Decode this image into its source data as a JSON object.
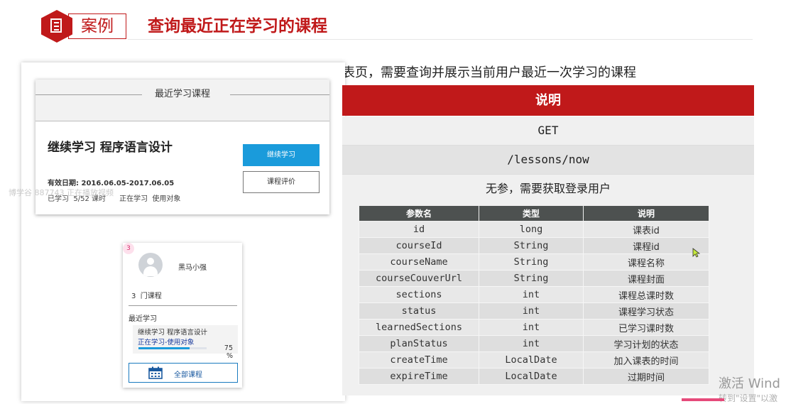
{
  "header": {
    "tag": "案例",
    "title": "查询最近正在学习的课程"
  },
  "intro_text": "表页，需要查询并展示当前用户最近一次学习的课程",
  "left_panel": {
    "card1": {
      "title": "最近学习课程",
      "course_line": "继续学习 程序语言设计",
      "valid_date": "有效日期: 2016.06.05-2017.06.05",
      "progress_info": "已学习  5/52 课时      正在学习  使用对象",
      "continue_button": "继续学习",
      "review_button": "课程评价"
    },
    "watermark": "博学谷 887743 正在播放视频",
    "card2": {
      "badge": "3",
      "username": "黑马小强",
      "course_count": "3  门课程",
      "recent_label": "最近学习",
      "recent_course": "继续学习 程序语言设计",
      "recent_status": "正在学习-使用对象",
      "progress_percent": 75,
      "progress_value": "75",
      "progress_unit": "%",
      "all_courses_button": "全部课程"
    }
  },
  "api_table": {
    "title": "说明",
    "method": "GET",
    "path": "/lessons/now",
    "params_note": "无参，需要获取登录用户",
    "columns": [
      "参数名",
      "类型",
      "说明"
    ],
    "rows": [
      [
        "id",
        "long",
        "课表id"
      ],
      [
        "courseId",
        "String",
        "课程id"
      ],
      [
        "courseName",
        "String",
        "课程名称"
      ],
      [
        "courseCouverUrl",
        "String",
        "课程封面"
      ],
      [
        "sections",
        "int",
        "课程总课时数"
      ],
      [
        "status",
        "int",
        "课程学习状态"
      ],
      [
        "learnedSections",
        "int",
        "已学习课时数"
      ],
      [
        "planStatus",
        "int",
        "学习计划的状态"
      ],
      [
        "createTime",
        "LocalDate",
        "加入课表的时间"
      ],
      [
        "expireTime",
        "LocalDate",
        "过期时间"
      ]
    ]
  },
  "system_overlay": {
    "activate_line1": "激活 Wind",
    "activate_line2": "转到\"设置\"以激"
  },
  "colors": {
    "brand_red": "#c0191a",
    "button_blue": "#1a9bdb",
    "table_header": "#4d5150"
  },
  "icons": [
    "document-icon",
    "avatar-icon",
    "calendar-icon",
    "cursor-icon"
  ]
}
